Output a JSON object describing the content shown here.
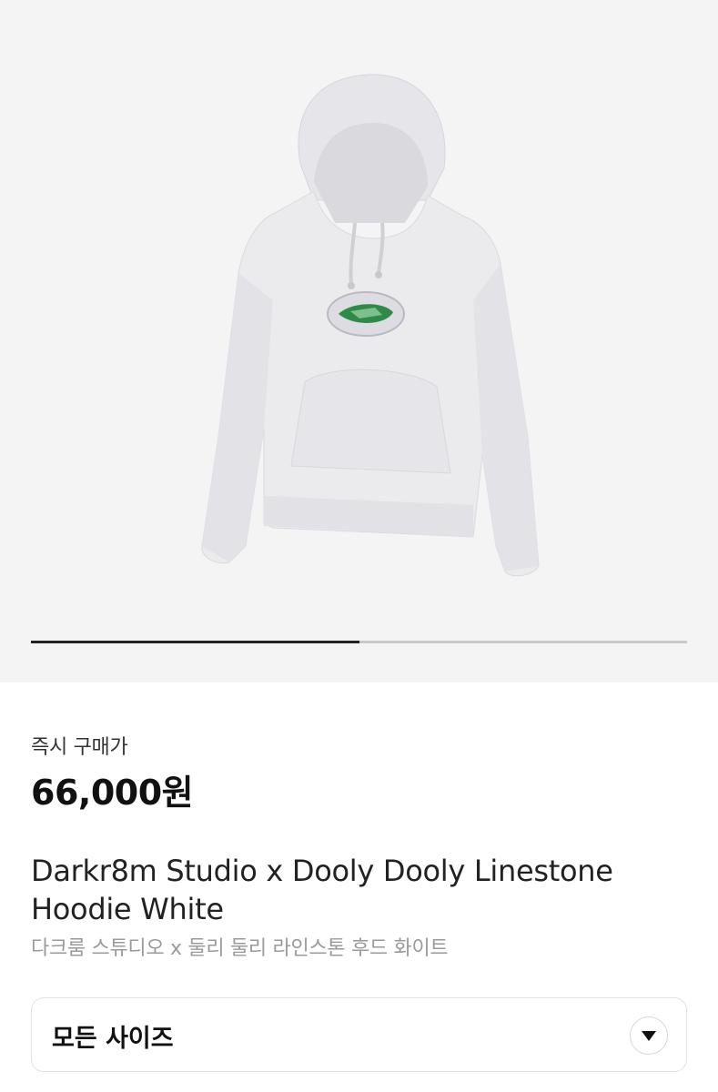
{
  "product": {
    "image_alt": "hoodie-product-photo",
    "carousel_progress": 0.5
  },
  "pricing": {
    "label": "즉시 구매가",
    "price": "66,000원"
  },
  "title": {
    "english": "Darkr8m Studio x Dooly Dooly Linestone Hoodie White",
    "korean": "다크룸 스튜디오 x 둘리 둘리 라인스톤 후드 화이트"
  },
  "size_selector": {
    "selected": "모든 사이즈",
    "icon": "chevron-down-icon"
  },
  "colors": {
    "hero_background": "#f4f4f4",
    "hoodie": "#e9e9ec",
    "graphic_green": "#2f8a4a"
  }
}
